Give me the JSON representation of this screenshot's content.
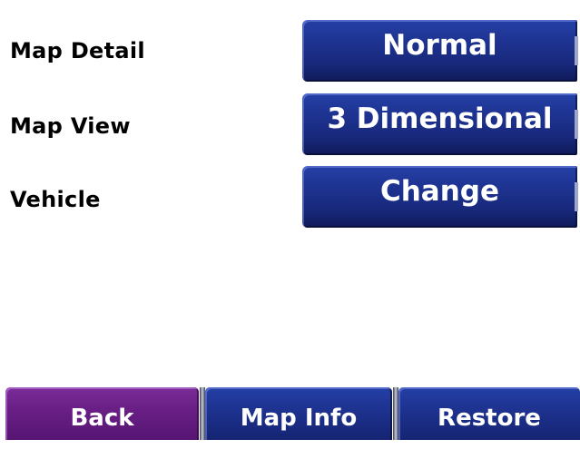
{
  "settings": [
    {
      "label": "Map Detail",
      "value": "Normal"
    },
    {
      "label": "Map View",
      "value": "3 Dimensional"
    },
    {
      "label": "Vehicle",
      "value": "Change"
    }
  ],
  "bottom_bar": {
    "back_label": "Back",
    "map_info_label": "Map Info",
    "restore_label": "Restore"
  },
  "colors": {
    "button_blue": "#1e3391",
    "back_purple": "#6a1f86",
    "background": "#ffffff",
    "label_text": "#000000",
    "button_text": "#ffffff"
  }
}
